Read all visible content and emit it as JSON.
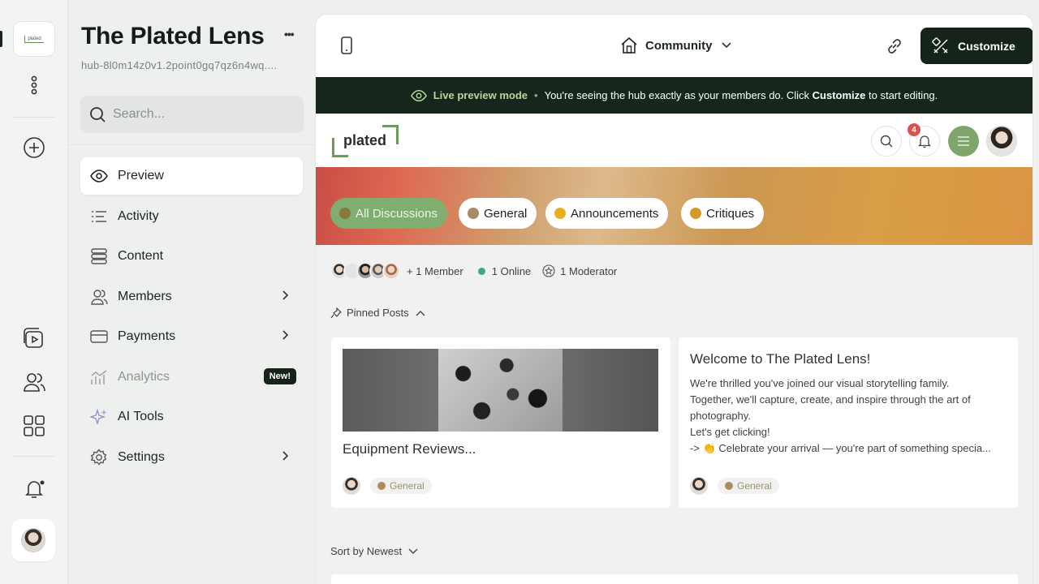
{
  "rail": {
    "logo_text": "plated"
  },
  "sidebar": {
    "title": "The Plated Lens",
    "more": "•••",
    "hub_id": "hub-8l0m14z0v1.2point0gq7qz6n4wq....",
    "search_placeholder": "Search...",
    "nav": [
      {
        "label": "Preview",
        "icon": "eye-icon"
      },
      {
        "label": "Activity",
        "icon": "list-icon"
      },
      {
        "label": "Content",
        "icon": "stack-icon"
      },
      {
        "label": "Members",
        "icon": "users-icon"
      },
      {
        "label": "Payments",
        "icon": "card-icon"
      },
      {
        "label": "Analytics",
        "icon": "chart-icon",
        "badge": "New!"
      },
      {
        "label": "AI Tools",
        "icon": "sparkle-icon"
      },
      {
        "label": "Settings",
        "icon": "gear-icon"
      }
    ]
  },
  "topbar": {
    "community": "Community",
    "customize": "Customize"
  },
  "banner": {
    "live": "Live preview mode",
    "sep": "•",
    "text_before": "You're seeing the hub exactly as your members do. Click ",
    "bold": "Customize",
    "text_after": " to start editing."
  },
  "hub": {
    "logo_word": "plated",
    "notif_count": "4"
  },
  "chips": [
    {
      "label": "All Discussions",
      "active": true,
      "color": "#8a7a3a"
    },
    {
      "label": "General",
      "active": false,
      "color": "#a88a64"
    },
    {
      "label": "Announcements",
      "active": false,
      "color": "#e8b020"
    },
    {
      "label": "Critiques",
      "active": false,
      "color": "#d49a2a"
    }
  ],
  "stats": {
    "members": "+ 1 Member",
    "online": "1 Online",
    "moderators": "1 Moderator"
  },
  "pinned": {
    "label": "Pinned Posts"
  },
  "posts": [
    {
      "title": "Equipment Reviews...",
      "tag": "General"
    },
    {
      "title": "Welcome to The Plated Lens!",
      "lines": [
        "We're thrilled you've joined our visual storytelling family.",
        "Together, we'll capture, create, and inspire through the art of",
        "photography.",
        "Let's get clicking!",
        "-> 👏 Celebrate your arrival — you're part of something specia..."
      ],
      "tag": "General"
    }
  ],
  "sort": {
    "label": "Sort by Newest"
  },
  "colors": {
    "accent_dark": "#15231b",
    "accent_green": "#7fae70",
    "banner_bg": "#16261d",
    "live_green": "#b9d79a"
  }
}
